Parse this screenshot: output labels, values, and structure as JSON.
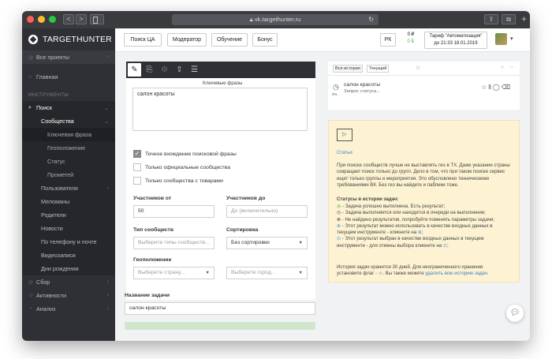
{
  "browser": {
    "url": "vk.targethunter.ru",
    "nav_back": "<",
    "nav_forward": ">",
    "reload_icon": "↻",
    "share_icon": "⇪",
    "tabs_icon": "⧉",
    "new_tab": "+"
  },
  "sidebar": {
    "brand": "TARGETHUNTER",
    "items": [
      {
        "label": "Все проекты"
      },
      {
        "label": "Главная"
      }
    ],
    "section_label": "ИНСТРУМЕНТЫ",
    "search": {
      "label": "Поиск"
    },
    "search_sub": {
      "label": "Сообщества"
    },
    "community_items": [
      {
        "label": "Ключевая фраза"
      },
      {
        "label": "Геоположение"
      },
      {
        "label": "Статус"
      },
      {
        "label": "Прометей"
      }
    ],
    "search_more": [
      {
        "label": "Пользователи"
      },
      {
        "label": "Меломаны"
      },
      {
        "label": "Родители"
      },
      {
        "label": "Новости"
      },
      {
        "label": "По телефону и почте"
      },
      {
        "label": "Видеозаписи"
      },
      {
        "label": "Дни рождения"
      }
    ],
    "bottom_items": [
      {
        "label": "Сбор"
      },
      {
        "label": "Активности"
      },
      {
        "label": "Анализ"
      }
    ]
  },
  "header": {
    "buttons": [
      "Поиск ЦА",
      "Модератор",
      "Обучение",
      "Бонус"
    ],
    "rk_label": "РК",
    "balance_top": "0 ₽",
    "balance_bottom": "0 Б",
    "tariff_line1": "Тариф \"Автоматизация\"",
    "tariff_line2": "до 21:33 18.01.2019"
  },
  "form": {
    "keywords_label": "Ключевые фразы",
    "keywords_value": "салон красоты",
    "checks": [
      {
        "label": "Точное вхождение поисковой фразы",
        "checked": true
      },
      {
        "label": "Только официальные сообщества",
        "checked": false
      },
      {
        "label": "Только сообщества с товарами",
        "checked": false
      }
    ],
    "members_from_label": "Участников от",
    "members_from_value": "50",
    "members_to_label": "Участников до",
    "members_to_placeholder": "До (включительно)",
    "type_label": "Тип сообществ",
    "type_placeholder": "Выберите типы сообществ...",
    "sort_label": "Сортировка",
    "sort_value": "Без сортировки",
    "geo_label": "Геоположение",
    "country_placeholder": "Выберите страну...",
    "city_placeholder": "Выберите город...",
    "task_name_label": "Название задачи",
    "task_name_value": "салон красоты"
  },
  "history": {
    "tab_all": "Вся история",
    "tab_current": "Текущий",
    "item_title": "салон красоты",
    "item_status": "Запрос статуса...",
    "item_progress": "0%"
  },
  "info": {
    "link_articles": "Статьи",
    "paragraph": "При поиске сообществ лучше не выставлять гео в ТХ. Даже указание страны сокращает поиск только до групп. Дело в том, что при таком поиске сервис ищет только группы и мероприятия. Это обусловлено техническими требованиями ВК. Без гео вы найдете и паблики тоже.",
    "statuses_title": "Статусы в истории задач:",
    "status_1": " - Задача успешно выполнена. Есть результат;",
    "status_2": " - Задача выполняется или находится в очереди на выполнение;",
    "status_3": " - Не найдено результатов, попробуйте поменять параметры задачи;",
    "status_4a": " - Этот результат можно использовать в качестве входных данных в",
    "status_4b": "текущем инструменте - кликните на",
    "status_5a": " - Этот результат выбран в качестве входных данных в текущем",
    "status_5b": "инструменте - для отмены выбора кликните на",
    "storage_1": "История задач хранится 30 дней. Для неограниченного хранения",
    "storage_2": "установите флаг - ☆. Вы также можете",
    "delete_link": "удалить всю историю задач."
  }
}
